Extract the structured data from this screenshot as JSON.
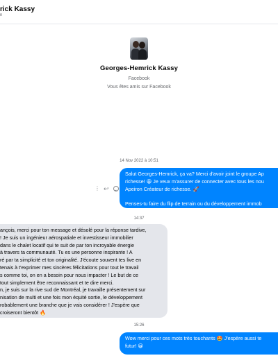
{
  "header": {
    "title": "rick Kassy",
    "subtitle": "n"
  },
  "profile": {
    "name": "Georges-Hemrick Kassy",
    "platform": "Facebook",
    "friends_note": "Vous êtes amis sur Facebook"
  },
  "messages": [
    {
      "timestamp": "14 Nov 2022 à 10:51",
      "sender": "me",
      "lines": [
        "Salut Georges-Hemrick, ça va? Merci d'avoir joint le groupe Ap",
        "richesse! 😀 Je veux m'assurer de connecter avec tous les nou",
        "Apeiron Créateur de richesse. 🚀",
        "",
        "Penses-tu faire du flip de terrain ou du développement immob"
      ],
      "hover_actions": [
        "more-icon",
        "reply-icon",
        "react-icon"
      ]
    },
    {
      "timestamp": "14:37",
      "sender": "them",
      "lines": [
        "ançois, merci pour ton message et désolé pour la réponse tardive,",
        "! Je suis un ingénieur aérospatiale et investisseur immobilier",
        "dans le chalet locatif qui te suit de par ton incroyable énergie",
        "à travers ta communauté. Tu es une personne inspirante ! A",
        "ré par ta simplicité et ton originalité. J'écoute souvent tes live en",
        "tenais à t'exprimer mes sincères félicitations pour tout le travail",
        "s comme toi, on en a besoin pour nous impacter ! Le but de ce",
        "tout simplement être reconnaissant et te dire merci.",
        "n, je suis sur la rive sud de Montréal, je travaille présentement sur",
        "nisation de multi et une fois mon équité sortie, le développement",
        "robablement une branche que je vais considérer ! J'espère que",
        "croiseront bientôt 🔥"
      ]
    },
    {
      "timestamp": "15:26",
      "sender": "me",
      "lines": [
        "Wow merci pour ces mots très touchants 🤩 J'espère aussi te",
        "futur! 😀"
      ]
    }
  ],
  "colors": {
    "outgoing_bubble": "#0084ff",
    "incoming_bubble": "#e4e6eb",
    "secondary_text": "#65676b"
  }
}
